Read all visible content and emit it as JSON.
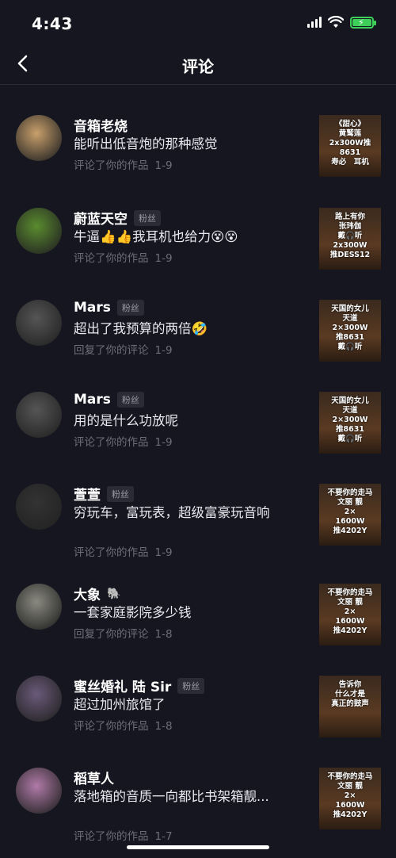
{
  "status": {
    "time": "4:43"
  },
  "nav": {
    "title": "评论"
  },
  "comments": [
    {
      "name": "音箱老烧",
      "badge": "",
      "emoji": "",
      "text": "能听出低音炮的那种感觉",
      "meta": "评论了你的作品",
      "date": "1-9",
      "thumb_lines": [
        "《甜心》",
        "黄鹫莲",
        "2x300W推8631",
        "寿必　耳机"
      ],
      "avatar_color": "#c9a06b"
    },
    {
      "name": "蔚蓝天空",
      "badge": "粉丝",
      "emoji": "",
      "text": "牛逼👍👍我耳机也给力😵😵",
      "meta": "评论了你的作品",
      "date": "1-9",
      "thumb_lines": [
        "路上有你",
        "张玮伽",
        "戴🎧听",
        "2x300W",
        "推DESS12"
      ],
      "avatar_color": "#5a8c2e"
    },
    {
      "name": "Mars",
      "badge": "粉丝",
      "emoji": "",
      "text": "超出了我预算的两倍🤣",
      "meta": "回复了你的评论",
      "date": "1-9",
      "thumb_lines": [
        "天国的女儿",
        "天道",
        "2×300W",
        "推8631",
        "戴🎧听"
      ],
      "avatar_color": "#555"
    },
    {
      "name": "Mars",
      "badge": "粉丝",
      "emoji": "",
      "text": "用的是什么功放呢",
      "meta": "评论了你的作品",
      "date": "1-9",
      "thumb_lines": [
        "天国的女儿",
        "天道",
        "2×300W",
        "推8631",
        "戴🎧听"
      ],
      "avatar_color": "#555"
    },
    {
      "name": "萱萱",
      "badge": "粉丝",
      "emoji": "",
      "text": "穷玩车，富玩表，超级富豪玩音响",
      "meta": "评论了你的作品",
      "date": "1-9",
      "thumb_lines": [
        "不要你的走马",
        "文丽 靓",
        "2×",
        "1600W",
        "推4202Y"
      ],
      "avatar_color": "#333"
    },
    {
      "name": "大象",
      "badge": "",
      "emoji": "🐘",
      "text": "一套家庭影院多少钱",
      "meta": "回复了你的评论",
      "date": "1-8",
      "thumb_lines": [
        "不要你的走马",
        "文丽 靓",
        "2×",
        "1600W",
        "推4202Y"
      ],
      "avatar_color": "#8a8a80"
    },
    {
      "name": "蜜丝婚礼  陆 Sir",
      "badge": "粉丝",
      "emoji": "",
      "text": "超过加州旅馆了",
      "meta": "评论了你的作品",
      "date": "1-8",
      "thumb_lines": [
        "告诉你",
        "什么才是",
        "真正的鼓声"
      ],
      "avatar_color": "#6a5a7a"
    },
    {
      "name": "稻草人",
      "badge": "",
      "emoji": "",
      "text": "落地箱的音质一向都比书架箱靓...",
      "meta": "评论了你的作品",
      "date": "1-7",
      "thumb_lines": [
        "不要你的走马",
        "文丽 靓",
        "2×",
        "1600W",
        "推4202Y"
      ],
      "avatar_color": "#b07aa8"
    }
  ]
}
